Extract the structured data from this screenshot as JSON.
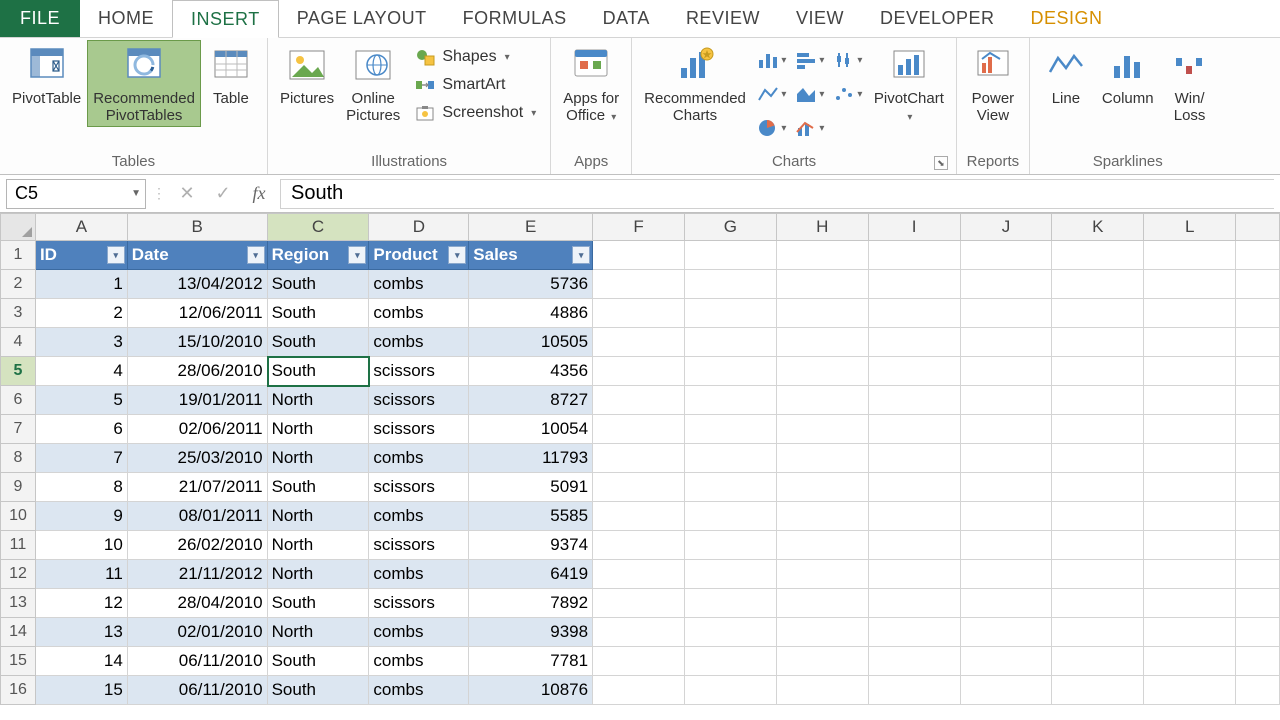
{
  "tabs": {
    "file": "FILE",
    "home": "HOME",
    "insert": "INSERT",
    "page_layout": "PAGE LAYOUT",
    "formulas": "FORMULAS",
    "data": "DATA",
    "review": "REVIEW",
    "view": "VIEW",
    "developer": "DEVELOPER",
    "design": "DESIGN"
  },
  "ribbon": {
    "tables": {
      "pivot": "PivotTable",
      "recommended1": "Recommended",
      "recommended2": "PivotTables",
      "table": "Table",
      "group": "Tables"
    },
    "illustrations": {
      "pictures": "Pictures",
      "online1": "Online",
      "online2": "Pictures",
      "shapes": "Shapes",
      "smartart": "SmartArt",
      "screenshot": "Screenshot",
      "group": "Illustrations"
    },
    "apps": {
      "label1": "Apps for",
      "label2": "Office",
      "group": "Apps"
    },
    "charts": {
      "recommended1": "Recommended",
      "recommended2": "Charts",
      "pivotchart": "PivotChart",
      "group": "Charts"
    },
    "reports": {
      "power1": "Power",
      "power2": "View",
      "group": "Reports"
    },
    "sparklines": {
      "line": "Line",
      "column": "Column",
      "winloss": "Win/\nLoss",
      "group": "Sparklines"
    }
  },
  "formula_bar": {
    "namebox": "C5",
    "value": "South"
  },
  "columns": [
    "A",
    "B",
    "C",
    "D",
    "E",
    "F",
    "G",
    "H",
    "I",
    "J",
    "K",
    "L"
  ],
  "selected_col": "C",
  "selected_row": 5,
  "table": {
    "headers": [
      "ID",
      "Date",
      "Region",
      "Product",
      "Sales"
    ],
    "rows": [
      {
        "id": 1,
        "date": "13/04/2012",
        "region": "South",
        "product": "combs",
        "sales": 5736
      },
      {
        "id": 2,
        "date": "12/06/2011",
        "region": "South",
        "product": "combs",
        "sales": 4886
      },
      {
        "id": 3,
        "date": "15/10/2010",
        "region": "South",
        "product": "combs",
        "sales": 10505
      },
      {
        "id": 4,
        "date": "28/06/2010",
        "region": "South",
        "product": "scissors",
        "sales": 4356
      },
      {
        "id": 5,
        "date": "19/01/2011",
        "region": "North",
        "product": "scissors",
        "sales": 8727
      },
      {
        "id": 6,
        "date": "02/06/2011",
        "region": "North",
        "product": "scissors",
        "sales": 10054
      },
      {
        "id": 7,
        "date": "25/03/2010",
        "region": "North",
        "product": "combs",
        "sales": 11793
      },
      {
        "id": 8,
        "date": "21/07/2011",
        "region": "South",
        "product": "scissors",
        "sales": 5091
      },
      {
        "id": 9,
        "date": "08/01/2011",
        "region": "North",
        "product": "combs",
        "sales": 5585
      },
      {
        "id": 10,
        "date": "26/02/2010",
        "region": "North",
        "product": "scissors",
        "sales": 9374
      },
      {
        "id": 11,
        "date": "21/11/2012",
        "region": "North",
        "product": "combs",
        "sales": 6419
      },
      {
        "id": 12,
        "date": "28/04/2010",
        "region": "South",
        "product": "scissors",
        "sales": 7892
      },
      {
        "id": 13,
        "date": "02/01/2010",
        "region": "North",
        "product": "combs",
        "sales": 9398
      },
      {
        "id": 14,
        "date": "06/11/2010",
        "region": "South",
        "product": "combs",
        "sales": 7781
      },
      {
        "id": 15,
        "date": "06/11/2010",
        "region": "South",
        "product": "combs",
        "sales": 10876
      }
    ]
  }
}
